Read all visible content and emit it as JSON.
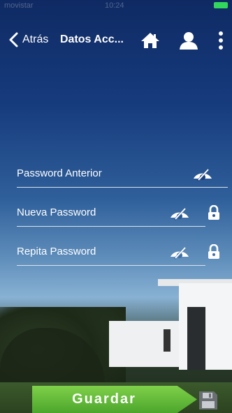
{
  "statusbar": {
    "carrier": "movistar",
    "time": "10:24"
  },
  "navbar": {
    "back_label": "Atrás",
    "title": "Datos Acc..."
  },
  "form": {
    "fields": [
      {
        "label": "Password Anterior"
      },
      {
        "label": "Nueva Password"
      },
      {
        "label": "Repita Password"
      }
    ]
  },
  "save": {
    "label": "Guardar"
  },
  "icons": {
    "back": "chevron-left-icon",
    "home": "home-icon",
    "user": "user-icon",
    "more": "more-vertical-icon",
    "visibility": "eye-slash-icon",
    "lock": "lock-icon",
    "save": "floppy-icon"
  },
  "colors": {
    "accent": "#5cb833",
    "text": "#ffffff",
    "battery": "#31d85b"
  }
}
